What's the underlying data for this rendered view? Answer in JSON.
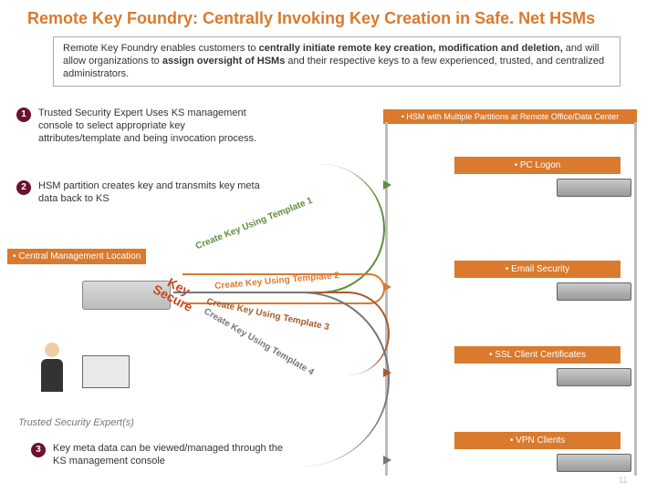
{
  "title": "Remote Key Foundry: Centrally Invoking Key Creation in Safe. Net HSMs",
  "intro": {
    "p1a": "Remote Key Foundry enables customers to ",
    "p1b": "centrally initiate remote key creation, modification and deletion,",
    "p2a": " and will allow organizations to ",
    "p2b": "assign oversight of HSMs",
    "p2c": " and their respective keys to a few experienced, trusted, and centralized administrators."
  },
  "steps": {
    "n1": "1",
    "t1": "Trusted Security Expert Uses KS management console to select appropriate key attributes/template and being invocation process.",
    "n2": "2",
    "t2": "HSM partition creates key and transmits key meta data back to KS",
    "n3": "3",
    "t3": "Key meta data can be viewed/managed through the KS management console"
  },
  "cm_label": "• Central Management Location",
  "ks_sticker_l1": "Key",
  "ks_sticker_l2": "Secure",
  "expert_label": "Trusted Security Expert(s)",
  "dc_header": "• HSM with Multiple Partitions at Remote Office/Data Center",
  "apps": {
    "a1": "• PC Logon",
    "a2": "• Email Security",
    "a3": "• SSL Client Certificates",
    "a4": "• VPN Clients"
  },
  "arcs": {
    "l1": "Create Key Using Template 1",
    "l2": "Create Key Using Template 2",
    "l3": "Create Key Using Template 3",
    "l4": "Create Key Using Template 4"
  },
  "colors": {
    "orange": "#d97a2e",
    "arc_green": "#5f8d3a",
    "arc_orange": "#d97a2e",
    "arc_brown": "#a65b2a",
    "arc_grey": "#777"
  },
  "page_number": "11"
}
